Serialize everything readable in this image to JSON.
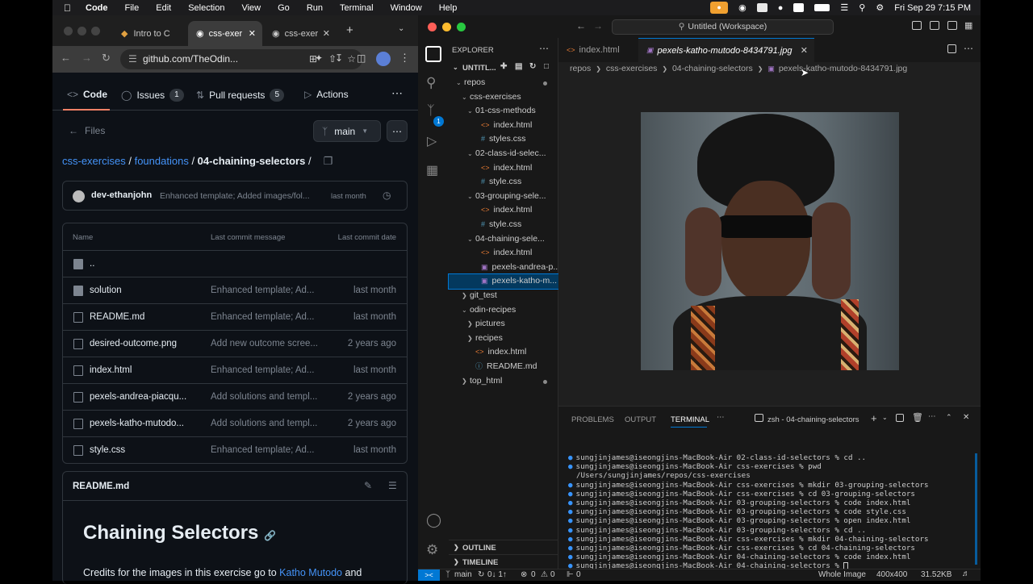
{
  "menubar": {
    "app": "Code",
    "items": [
      "File",
      "Edit",
      "Selection",
      "View",
      "Go",
      "Run",
      "Terminal",
      "Window",
      "Help"
    ],
    "datetime": "Fri Sep 29  7:15 PM"
  },
  "browser": {
    "tabs": [
      "Intro to C",
      "css-exer",
      "css-exer"
    ],
    "url": "github.com/TheOdin...",
    "nav": {
      "code": "Code",
      "issues": "Issues",
      "issues_count": "1",
      "pulls": "Pull requests",
      "pulls_count": "5",
      "actions": "Actions"
    },
    "files_label": "Files",
    "branch": "main",
    "breadcrumb": {
      "a": "css-exercises",
      "b": "foundations",
      "c": "04-chaining-selectors",
      "sep": " / "
    },
    "commit": {
      "author": "dev-ethanjohn",
      "message": "Enhanced template; Added images/fol...",
      "time": "last month"
    },
    "table": {
      "headers": [
        "Name",
        "Last commit message",
        "Last commit date"
      ],
      "rows": [
        {
          "name": "..",
          "message": "",
          "date": "",
          "type": "folder"
        },
        {
          "name": "solution",
          "message": "Enhanced template; Ad...",
          "date": "last month",
          "type": "folder"
        },
        {
          "name": "README.md",
          "message": "Enhanced template; Ad...",
          "date": "last month",
          "type": "file"
        },
        {
          "name": "desired-outcome.png",
          "message": "Add new outcome scree...",
          "date": "2 years ago",
          "type": "file"
        },
        {
          "name": "index.html",
          "message": "Enhanced template; Ad...",
          "date": "last month",
          "type": "file"
        },
        {
          "name": "pexels-andrea-piacqu...",
          "message": "Add solutions and templ...",
          "date": "2 years ago",
          "type": "file"
        },
        {
          "name": "pexels-katho-mutodo...",
          "message": "Add solutions and templ...",
          "date": "2 years ago",
          "type": "file"
        },
        {
          "name": "style.css",
          "message": "Enhanced template; Ad...",
          "date": "last month",
          "type": "file"
        }
      ]
    },
    "readme": {
      "label": "README.md",
      "heading": "Chaining Selectors",
      "text_prefix": "Credits for the images in this exercise go to ",
      "text_link": "Katho Mutodo",
      "text_suffix": " and"
    }
  },
  "vscode": {
    "title": "Untitled (Workspace)",
    "explorer": {
      "header": "EXPLORER",
      "workspace": "UNTITL...",
      "tree": [
        {
          "depth": 1,
          "label": "repos",
          "kind": "folder",
          "open": true,
          "dot": true
        },
        {
          "depth": 2,
          "label": "css-exercises",
          "kind": "folder",
          "open": true
        },
        {
          "depth": 3,
          "label": "01-css-methods",
          "kind": "folder",
          "open": true
        },
        {
          "depth": 4,
          "label": "index.html",
          "kind": "html"
        },
        {
          "depth": 4,
          "label": "styles.css",
          "kind": "css"
        },
        {
          "depth": 3,
          "label": "02-class-id-selec...",
          "kind": "folder",
          "open": true
        },
        {
          "depth": 4,
          "label": "index.html",
          "kind": "html"
        },
        {
          "depth": 4,
          "label": "style.css",
          "kind": "css"
        },
        {
          "depth": 3,
          "label": "03-grouping-sele...",
          "kind": "folder",
          "open": true
        },
        {
          "depth": 4,
          "label": "index.html",
          "kind": "html"
        },
        {
          "depth": 4,
          "label": "style.css",
          "kind": "css"
        },
        {
          "depth": 3,
          "label": "04-chaining-sele...",
          "kind": "folder",
          "open": true
        },
        {
          "depth": 4,
          "label": "index.html",
          "kind": "html"
        },
        {
          "depth": 4,
          "label": "pexels-andrea-p...",
          "kind": "img"
        },
        {
          "depth": 4,
          "label": "pexels-katho-m...",
          "kind": "img",
          "selected": true
        },
        {
          "depth": 2,
          "label": "git_test",
          "kind": "folder",
          "open": false
        },
        {
          "depth": 2,
          "label": "odin-recipes",
          "kind": "folder",
          "open": true
        },
        {
          "depth": 3,
          "label": "pictures",
          "kind": "folder",
          "open": false
        },
        {
          "depth": 3,
          "label": "recipes",
          "kind": "folder",
          "open": false
        },
        {
          "depth": 3,
          "label": "index.html",
          "kind": "html"
        },
        {
          "depth": 3,
          "label": "README.md",
          "kind": "md"
        },
        {
          "depth": 2,
          "label": "top_html",
          "kind": "folder",
          "open": false,
          "dot": true
        }
      ],
      "outline": "OUTLINE",
      "timeline": "TIMELINE"
    },
    "tabs": [
      "index.html",
      "pexels-katho-mutodo-8434791.jpg"
    ],
    "breadcrumb": [
      "repos",
      "css-exercises",
      "04-chaining-selectors",
      "pexels-katho-mutodo-8434791.jpg"
    ],
    "panel": {
      "tabs": [
        "PROBLEMS",
        "OUTPUT",
        "TERMINAL"
      ],
      "shell": "zsh - 04-chaining-selectors",
      "lines": [
        "sungjinjames@iseongjins-MacBook-Air 02-class-id-selectors % cd ..",
        "sungjinjames@iseongjins-MacBook-Air css-exercises % pwd",
        "/Users/sungjinjames/repos/css-exercises",
        "sungjinjames@iseongjins-MacBook-Air css-exercises % mkdir 03-grouping-selectors",
        "sungjinjames@iseongjins-MacBook-Air css-exercises % cd 03-grouping-selectors",
        "sungjinjames@iseongjins-MacBook-Air 03-grouping-selectors % code index.html",
        "sungjinjames@iseongjins-MacBook-Air 03-grouping-selectors % code style.css",
        "sungjinjames@iseongjins-MacBook-Air 03-grouping-selectors % open index.html",
        "sungjinjames@iseongjins-MacBook-Air 03-grouping-selectors % cd ..",
        "sungjinjames@iseongjins-MacBook-Air css-exercises % mkdir 04-chaining-selectors",
        "sungjinjames@iseongjins-MacBook-Air css-exercises % cd 04-chaining-selectors",
        "sungjinjames@iseongjins-MacBook-Air 04-chaining-selectors % code index.html",
        "sungjinjames@iseongjins-MacBook-Air 04-chaining-selectors % "
      ]
    },
    "status": {
      "branch": "main",
      "sync": "0↓ 1↑",
      "errors": "0",
      "warnings": "0",
      "ports": "0",
      "zoom": "Whole Image",
      "dims": "400x400",
      "size": "31.52KB"
    },
    "colors": {
      "accent": "#0078d4",
      "status_remote": "#0078d4"
    }
  }
}
